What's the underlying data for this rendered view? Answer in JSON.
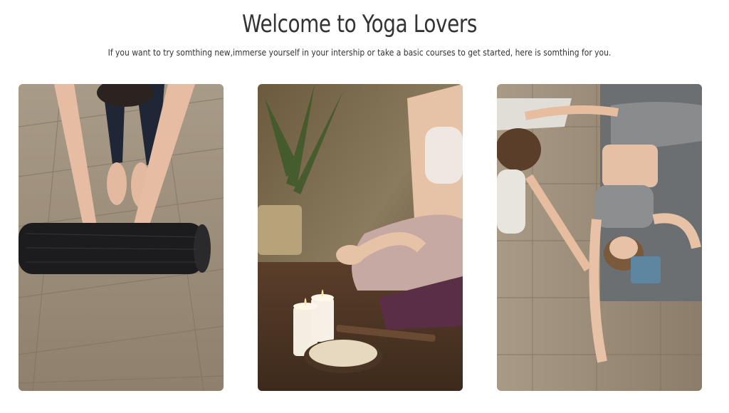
{
  "header": {
    "title": "Welcome to Yoga Lovers",
    "subtitle": "If you want to try somthing new,immerse yourself in your intership or take a basic courses to get started, here is somthing for you."
  },
  "cards": [
    {
      "image": "photo-rolling-yoga-mat"
    },
    {
      "image": "photo-meditation-candles"
    },
    {
      "image": "photo-assisted-stretch"
    }
  ]
}
